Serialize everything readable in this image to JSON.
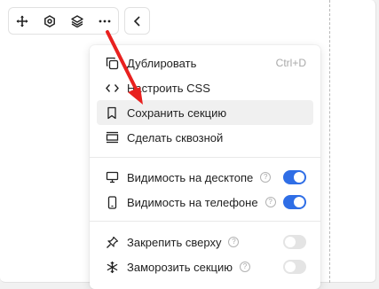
{
  "toolbar": {
    "buttons": [
      {
        "icon": "move-icon"
      },
      {
        "icon": "settings-icon"
      },
      {
        "icon": "layers-icon"
      },
      {
        "icon": "more-icon"
      }
    ],
    "back_icon": "chevron-left-icon"
  },
  "menu": {
    "group1": [
      {
        "icon": "copy-icon",
        "label": "Дублировать",
        "shortcut": "Ctrl+D"
      },
      {
        "icon": "code-icon",
        "label": "Настроить CSS"
      },
      {
        "icon": "bookmark-icon",
        "label": "Сохранить секцию",
        "highlighted": true
      },
      {
        "icon": "global-section-icon",
        "label": "Сделать сквозной"
      }
    ],
    "group2": [
      {
        "icon": "desktop-icon",
        "label": "Видимость на десктопе",
        "help": "?",
        "toggle": true
      },
      {
        "icon": "phone-icon",
        "label": "Видимость на телефоне",
        "help": "?",
        "toggle": true
      }
    ],
    "group3": [
      {
        "icon": "pin-icon",
        "label": "Закрепить сверху",
        "help": "?",
        "toggle": false
      },
      {
        "icon": "snowflake-icon",
        "label": "Заморозить секцию",
        "help": "?",
        "toggle": false
      }
    ]
  },
  "colors": {
    "accent": "#2f6ee6",
    "arrow": "#e8211f",
    "highlight": "#f0f0f0"
  }
}
